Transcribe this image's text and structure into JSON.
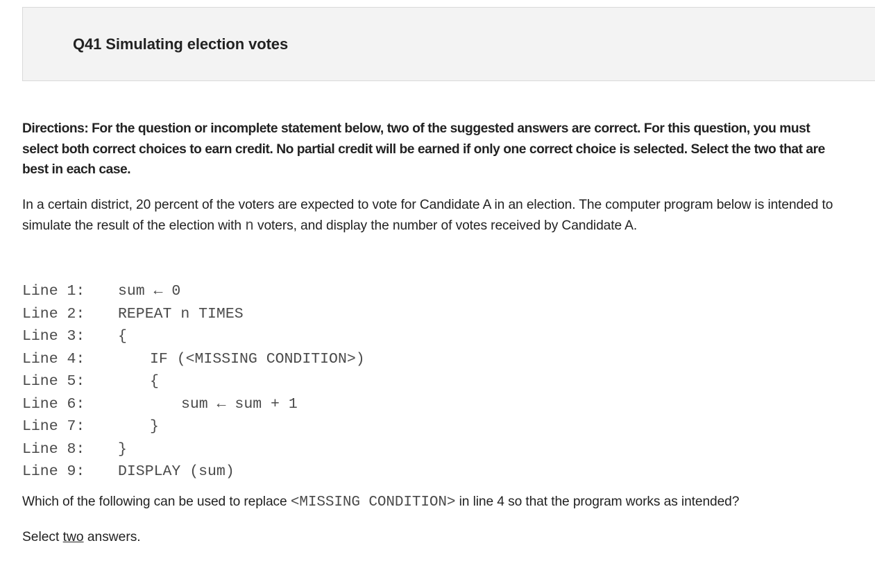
{
  "header": {
    "title": "Q41 Simulating election votes"
  },
  "directions": "Directions: For the question or incomplete statement below, two of the suggested answers are correct. For this question, you must select both correct choices to earn credit. No partial credit will be earned if only one correct choice is selected. Select the two that are best in each case.",
  "prompt": {
    "before": "In a certain district, 20 percent of the voters are expected to vote for Candidate A in an election. The computer program below is intended to simulate the result of the election with ",
    "variable": "n",
    "after": " voters, and display the number of votes received by Candidate A."
  },
  "code": {
    "lines": [
      {
        "label": "Line 1:",
        "text": "sum ← 0"
      },
      {
        "label": "Line 2:",
        "text": "REPEAT n TIMES"
      },
      {
        "label": "Line 3:",
        "text": "{"
      },
      {
        "label": "Line 4:",
        "text": "IF (<MISSING CONDITION>)"
      },
      {
        "label": "Line 5:",
        "text": "{"
      },
      {
        "label": "Line 6:",
        "text": "sum ← sum + 1"
      },
      {
        "label": "Line 7:",
        "text": "}"
      },
      {
        "label": "Line 8:",
        "text": "}"
      },
      {
        "label": "Line 9:",
        "text": "DISPLAY (sum)"
      }
    ]
  },
  "question": {
    "before": "Which of the following can be used to replace ",
    "code": "<MISSING CONDITION>",
    "after": " in line 4 so that the program works as intended?"
  },
  "instruction": {
    "before": "Select ",
    "emphasis": "two",
    "after": " answers."
  }
}
